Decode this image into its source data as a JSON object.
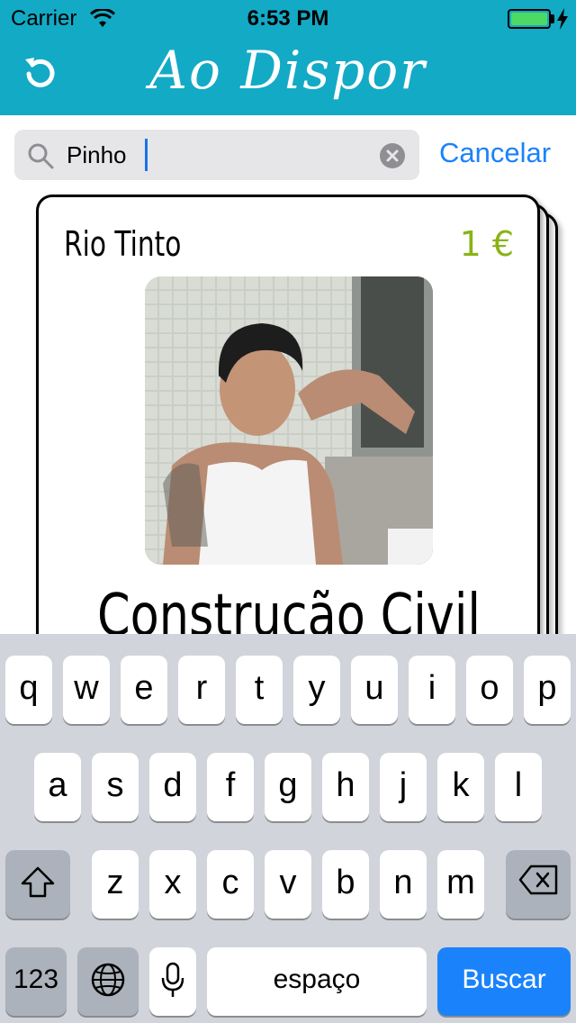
{
  "status_bar": {
    "carrier": "Carrier",
    "time": "6:53 PM",
    "battery_level": 1.0,
    "battery_color": "#4cd964"
  },
  "nav": {
    "title": "Ao Dispor",
    "left_icon": "refresh-icon",
    "bar_color": "#13aac6"
  },
  "search": {
    "value": "Pinho",
    "cancel_label": "Cancelar",
    "icon": "search-icon",
    "clear_icon": "clear-icon"
  },
  "card": {
    "location": "Rio Tinto",
    "price": "1 €",
    "price_color": "#8ab316",
    "category": "Construção Civil",
    "photo": "profile-photo"
  },
  "keyboard": {
    "row1": [
      "q",
      "w",
      "e",
      "r",
      "t",
      "y",
      "u",
      "i",
      "o",
      "p"
    ],
    "row2": [
      "a",
      "s",
      "d",
      "f",
      "g",
      "h",
      "j",
      "k",
      "l"
    ],
    "row3": [
      "z",
      "x",
      "c",
      "v",
      "b",
      "n",
      "m"
    ],
    "numbers_label": "123",
    "space_label": "espaço",
    "return_label": "Buscar",
    "return_color": "#1a82fb"
  }
}
